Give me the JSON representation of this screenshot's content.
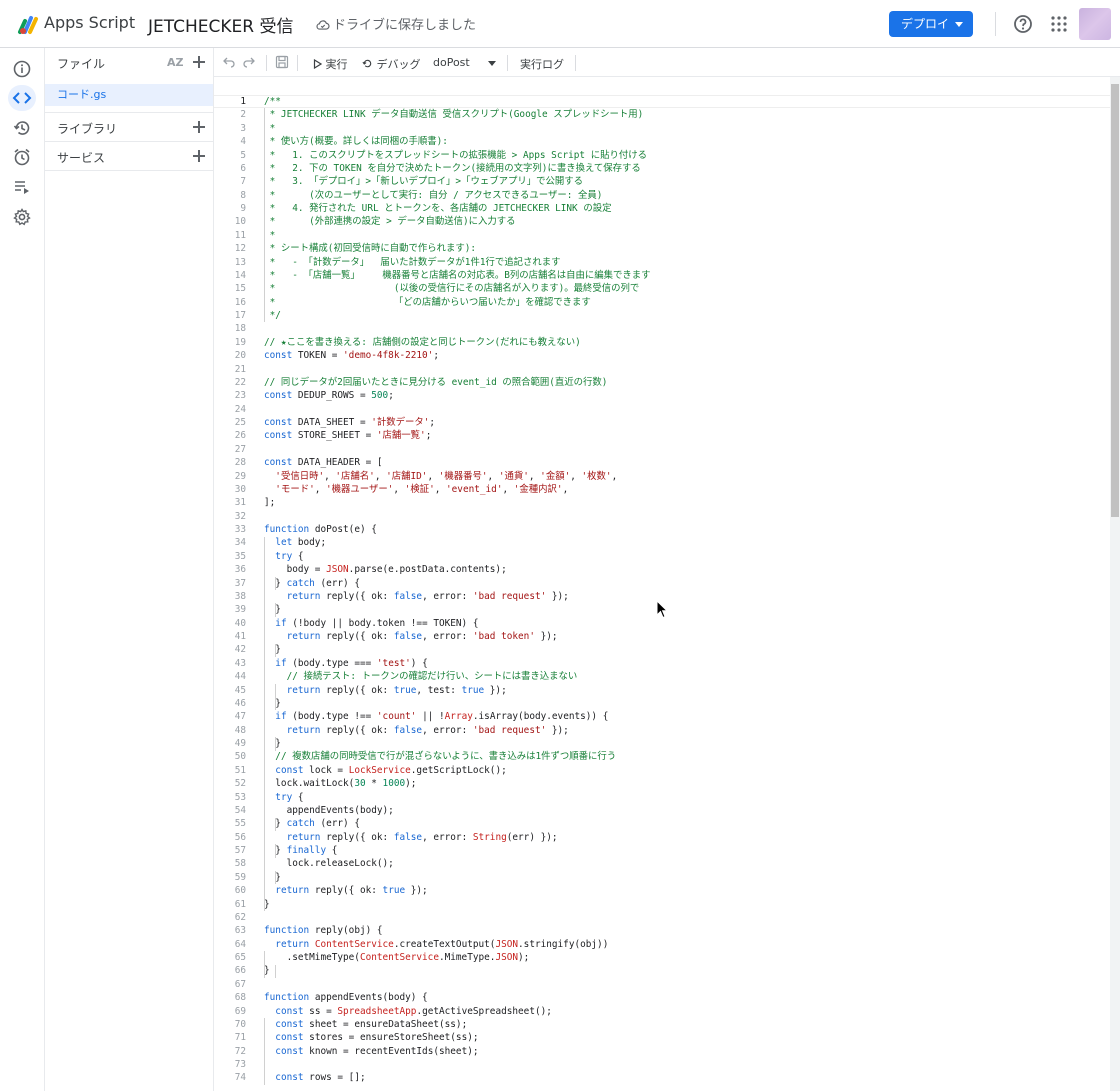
{
  "app": {
    "name": "Apps Script",
    "project_title": "JETCHECKER 受信",
    "save_status": "ドライブに保存しました"
  },
  "header": {
    "deploy_label": "デプロイ"
  },
  "files_panel": {
    "title": "ファイル",
    "sort_label": "AZ",
    "files": [
      "コード.gs"
    ],
    "libraries_label": "ライブラリ",
    "services_label": "サービス"
  },
  "toolbar": {
    "run_label": "実行",
    "debug_label": "デバッグ",
    "function_name": "doPost",
    "log_label": "実行ログ"
  },
  "icons": [
    "apps-script-logo",
    "cloud-done-icon",
    "help-icon",
    "apps-grid-icon",
    "info-icon",
    "code-icon",
    "history-icon",
    "alarm-icon",
    "executions-icon",
    "settings-icon",
    "undo-icon",
    "redo-icon",
    "save-icon",
    "play-icon",
    "debug-icon"
  ],
  "colors": {
    "accent": "#1a73e8",
    "comment": "#188038",
    "keyword": "#1967d2",
    "string": "#a31515",
    "number": "#098658"
  },
  "editor": {
    "current_line": 1,
    "lines": [
      [
        [
          "c",
          "/**"
        ]
      ],
      [
        [
          "c",
          " * JETCHECKER LINK データ自動送信 受信スクリプト(Google スプレッドシート用)"
        ]
      ],
      [
        [
          "c",
          " *"
        ]
      ],
      [
        [
          "c",
          " * 使い方(概要。詳しくは同梱の手順書):"
        ]
      ],
      [
        [
          "c",
          " *   1. このスクリプトをスプレッドシートの拡張機能 > Apps Script に貼り付ける"
        ]
      ],
      [
        [
          "c",
          " *   2. 下の TOKEN を自分で決めたトークン(接続用の文字列)に書き換えて保存する"
        ]
      ],
      [
        [
          "c",
          " *   3. 「デプロイ」>「新しいデプロイ」>「ウェブアプリ」で公開する"
        ]
      ],
      [
        [
          "c",
          " *      (次のユーザーとして実行: 自分 / アクセスできるユーザー: 全員)"
        ]
      ],
      [
        [
          "c",
          " *   4. 発行された URL とトークンを、各店舗の JETCHECKER LINK の設定"
        ]
      ],
      [
        [
          "c",
          " *      (外部連携の設定 > データ自動送信)に入力する"
        ]
      ],
      [
        [
          "c",
          " *"
        ]
      ],
      [
        [
          "c",
          " * シート構成(初回受信時に自動で作られます):"
        ]
      ],
      [
        [
          "c",
          " *   - 「計数データ」  届いた計数データが1件1行で追記されます"
        ]
      ],
      [
        [
          "c",
          " *   - 「店舗一覧」    機器番号と店舗名の対応表。B列の店舗名は自由に編集できます"
        ]
      ],
      [
        [
          "c",
          " *                     (以後の受信行にその店舗名が入ります)。最終受信の列で"
        ]
      ],
      [
        [
          "c",
          " *                     「どの店舗からいつ届いたか」を確認できます"
        ]
      ],
      [
        [
          "c",
          " */"
        ]
      ],
      [],
      [
        [
          "c",
          "// ★ここを書き換える: 店舗側の設定と同じトークン(だれにも教えない)"
        ]
      ],
      [
        [
          "k",
          "const "
        ],
        [
          "p",
          "TOKEN = "
        ],
        [
          "s",
          "'demo-4f8k-2210'"
        ],
        [
          "p",
          ";"
        ]
      ],
      [],
      [
        [
          "c",
          "// 同じデータが2回届いたときに見分ける event_id の照合範囲(直近の行数)"
        ]
      ],
      [
        [
          "k",
          "const "
        ],
        [
          "p",
          "DEDUP_ROWS = "
        ],
        [
          "n",
          "500"
        ],
        [
          "p",
          ";"
        ]
      ],
      [],
      [
        [
          "k",
          "const "
        ],
        [
          "p",
          "DATA_SHEET = "
        ],
        [
          "s",
          "'計数データ'"
        ],
        [
          "p",
          ";"
        ]
      ],
      [
        [
          "k",
          "const "
        ],
        [
          "p",
          "STORE_SHEET = "
        ],
        [
          "s",
          "'店舗一覧'"
        ],
        [
          "p",
          ";"
        ]
      ],
      [],
      [
        [
          "k",
          "const "
        ],
        [
          "p",
          "DATA_HEADER = ["
        ]
      ],
      [
        [
          "p",
          "  "
        ],
        [
          "s",
          "'受信日時'"
        ],
        [
          "p",
          ", "
        ],
        [
          "s",
          "'店舗名'"
        ],
        [
          "p",
          ", "
        ],
        [
          "s",
          "'店舗ID'"
        ],
        [
          "p",
          ", "
        ],
        [
          "s",
          "'機器番号'"
        ],
        [
          "p",
          ", "
        ],
        [
          "s",
          "'通貨'"
        ],
        [
          "p",
          ", "
        ],
        [
          "s",
          "'金額'"
        ],
        [
          "p",
          ", "
        ],
        [
          "s",
          "'枚数'"
        ],
        [
          "p",
          ","
        ]
      ],
      [
        [
          "p",
          "  "
        ],
        [
          "s",
          "'モード'"
        ],
        [
          "p",
          ", "
        ],
        [
          "s",
          "'機器ユーザー'"
        ],
        [
          "p",
          ", "
        ],
        [
          "s",
          "'検証'"
        ],
        [
          "p",
          ", "
        ],
        [
          "s",
          "'event_id'"
        ],
        [
          "p",
          ", "
        ],
        [
          "s",
          "'金種内訳'"
        ],
        [
          "p",
          ","
        ]
      ],
      [
        [
          "p",
          "];"
        ]
      ],
      [],
      [
        [
          "k",
          "function "
        ],
        [
          "p",
          "doPost(e) {"
        ]
      ],
      [
        [
          "p",
          "  "
        ],
        [
          "k",
          "let "
        ],
        [
          "p",
          "body;"
        ]
      ],
      [
        [
          "p",
          "  "
        ],
        [
          "k",
          "try "
        ],
        [
          "p",
          "{"
        ]
      ],
      [
        [
          "p",
          "    body = "
        ],
        [
          "o",
          "JSON"
        ],
        [
          "p",
          ".parse(e.postData.contents);"
        ]
      ],
      [
        [
          "p",
          "  } "
        ],
        [
          "k",
          "catch "
        ],
        [
          "p",
          "(err) {"
        ]
      ],
      [
        [
          "p",
          "    "
        ],
        [
          "k",
          "return "
        ],
        [
          "p",
          "reply({ ok: "
        ],
        [
          "k",
          "false"
        ],
        [
          "p",
          ", error: "
        ],
        [
          "s",
          "'bad request'"
        ],
        [
          "p",
          " });"
        ]
      ],
      [
        [
          "p",
          "  }"
        ]
      ],
      [
        [
          "p",
          "  "
        ],
        [
          "k",
          "if "
        ],
        [
          "p",
          "(!body || body.token !== TOKEN) {"
        ]
      ],
      [
        [
          "p",
          "    "
        ],
        [
          "k",
          "return "
        ],
        [
          "p",
          "reply({ ok: "
        ],
        [
          "k",
          "false"
        ],
        [
          "p",
          ", error: "
        ],
        [
          "s",
          "'bad token'"
        ],
        [
          "p",
          " });"
        ]
      ],
      [
        [
          "p",
          "  }"
        ]
      ],
      [
        [
          "p",
          "  "
        ],
        [
          "k",
          "if "
        ],
        [
          "p",
          "(body.type === "
        ],
        [
          "s",
          "'test'"
        ],
        [
          "p",
          ") {"
        ]
      ],
      [
        [
          "p",
          "    "
        ],
        [
          "c",
          "// 接続テスト: トークンの確認だけ行い、シートには書き込まない"
        ]
      ],
      [
        [
          "p",
          "    "
        ],
        [
          "k",
          "return "
        ],
        [
          "p",
          "reply({ ok: "
        ],
        [
          "k",
          "true"
        ],
        [
          "p",
          ", test: "
        ],
        [
          "k",
          "true"
        ],
        [
          "p",
          " });"
        ]
      ],
      [
        [
          "p",
          "  }"
        ]
      ],
      [
        [
          "p",
          "  "
        ],
        [
          "k",
          "if "
        ],
        [
          "p",
          "(body.type !== "
        ],
        [
          "s",
          "'count'"
        ],
        [
          "p",
          " || !"
        ],
        [
          "o",
          "Array"
        ],
        [
          "p",
          ".isArray(body.events)) {"
        ]
      ],
      [
        [
          "p",
          "    "
        ],
        [
          "k",
          "return "
        ],
        [
          "p",
          "reply({ ok: "
        ],
        [
          "k",
          "false"
        ],
        [
          "p",
          ", error: "
        ],
        [
          "s",
          "'bad request'"
        ],
        [
          "p",
          " });"
        ]
      ],
      [
        [
          "p",
          "  }"
        ]
      ],
      [
        [
          "p",
          "  "
        ],
        [
          "c",
          "// 複数店舗の同時受信で行が混ざらないように、書き込みは1件ずつ順番に行う"
        ]
      ],
      [
        [
          "p",
          "  "
        ],
        [
          "k",
          "const "
        ],
        [
          "p",
          "lock = "
        ],
        [
          "o",
          "LockService"
        ],
        [
          "p",
          ".getScriptLock();"
        ]
      ],
      [
        [
          "p",
          "  lock.waitLock("
        ],
        [
          "n",
          "30"
        ],
        [
          "p",
          " * "
        ],
        [
          "n",
          "1000"
        ],
        [
          "p",
          ");"
        ]
      ],
      [
        [
          "p",
          "  "
        ],
        [
          "k",
          "try "
        ],
        [
          "p",
          "{"
        ]
      ],
      [
        [
          "p",
          "    appendEvents(body);"
        ]
      ],
      [
        [
          "p",
          "  } "
        ],
        [
          "k",
          "catch "
        ],
        [
          "p",
          "(err) {"
        ]
      ],
      [
        [
          "p",
          "    "
        ],
        [
          "k",
          "return "
        ],
        [
          "p",
          "reply({ ok: "
        ],
        [
          "k",
          "false"
        ],
        [
          "p",
          ", error: "
        ],
        [
          "o",
          "String"
        ],
        [
          "p",
          "(err) });"
        ]
      ],
      [
        [
          "p",
          "  } "
        ],
        [
          "k",
          "finally "
        ],
        [
          "p",
          "{"
        ]
      ],
      [
        [
          "p",
          "    lock.releaseLock();"
        ]
      ],
      [
        [
          "p",
          "  }"
        ]
      ],
      [
        [
          "p",
          "  "
        ],
        [
          "k",
          "return "
        ],
        [
          "p",
          "reply({ ok: "
        ],
        [
          "k",
          "true"
        ],
        [
          "p",
          " });"
        ]
      ],
      [
        [
          "p",
          "}"
        ]
      ],
      [],
      [
        [
          "k",
          "function "
        ],
        [
          "p",
          "reply(obj) {"
        ]
      ],
      [
        [
          "p",
          "  "
        ],
        [
          "k",
          "return "
        ],
        [
          "o",
          "ContentService"
        ],
        [
          "p",
          ".createTextOutput("
        ],
        [
          "o",
          "JSON"
        ],
        [
          "p",
          ".stringify(obj))"
        ]
      ],
      [
        [
          "p",
          "    .setMimeType("
        ],
        [
          "o",
          "ContentService"
        ],
        [
          "p",
          ".MimeType."
        ],
        [
          "o",
          "JSON"
        ],
        [
          "p",
          ");"
        ]
      ],
      [
        [
          "p",
          "}"
        ]
      ],
      [],
      [
        [
          "k",
          "function "
        ],
        [
          "p",
          "appendEvents(body) {"
        ]
      ],
      [
        [
          "p",
          "  "
        ],
        [
          "k",
          "const "
        ],
        [
          "p",
          "ss = "
        ],
        [
          "o",
          "SpreadsheetApp"
        ],
        [
          "p",
          ".getActiveSpreadsheet();"
        ]
      ],
      [
        [
          "p",
          "  "
        ],
        [
          "k",
          "const "
        ],
        [
          "p",
          "sheet = ensureDataSheet(ss);"
        ]
      ],
      [
        [
          "p",
          "  "
        ],
        [
          "k",
          "const "
        ],
        [
          "p",
          "stores = ensureStoreSheet(ss);"
        ]
      ],
      [
        [
          "p",
          "  "
        ],
        [
          "k",
          "const "
        ],
        [
          "p",
          "known = recentEventIds(sheet);"
        ]
      ],
      [],
      [
        [
          "p",
          "  "
        ],
        [
          "k",
          "const "
        ],
        [
          "p",
          "rows = [];"
        ]
      ]
    ]
  }
}
